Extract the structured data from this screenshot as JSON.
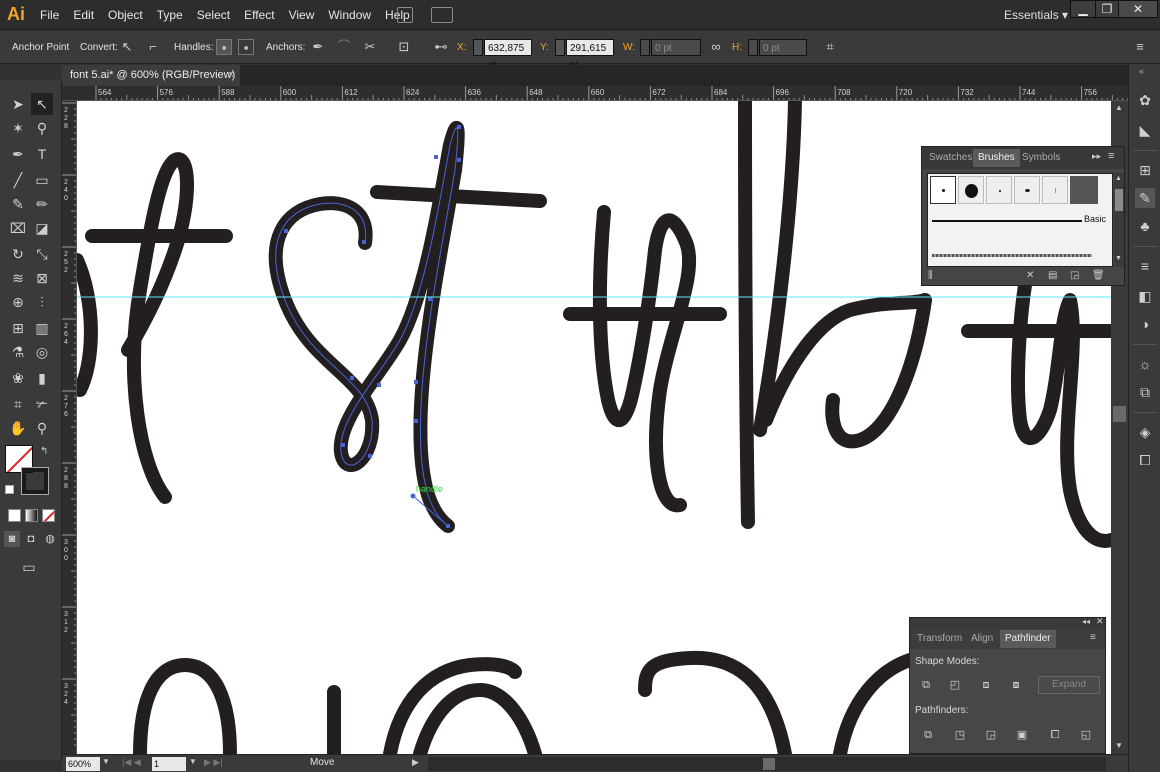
{
  "app": {
    "logo": "Ai"
  },
  "menu": [
    "File",
    "Edit",
    "Object",
    "Type",
    "Select",
    "Effect",
    "View",
    "Window",
    "Help"
  ],
  "workspace": {
    "label": "Essentials",
    "arrow": "▾"
  },
  "window_controls": {
    "minimize": "▁",
    "restore": "❐",
    "close": "✕"
  },
  "control_bar": {
    "anchor_point": "Anchor Point",
    "convert": "Convert:",
    "handles": "Handles:",
    "anchors": "Anchors:",
    "x_label": "X:",
    "x_value": "632,875 pt",
    "y_label": "Y:",
    "y_value": "291,615 pt",
    "w_label": "W:",
    "w_value": "0 pt",
    "h_label": "H:",
    "h_value": "0 pt"
  },
  "document_tab": {
    "title": "font 5.ai* @ 600% (RGB/Preview)",
    "close": "×"
  },
  "ruler": {
    "h_ticks": [
      "564",
      "576",
      "588",
      "600",
      "612",
      "624",
      "636",
      "648",
      "660",
      "672",
      "684",
      "696",
      "708",
      "720",
      "732",
      "744",
      "756"
    ],
    "v_ticks": [
      "228",
      "240",
      "252",
      "264",
      "276",
      "288",
      "300",
      "312",
      "324"
    ]
  },
  "canvas": {
    "handle_label": "handle"
  },
  "brushes_panel": {
    "tabs": [
      "Swatches",
      "Brushes",
      "Symbols"
    ],
    "active_tab": "Brushes",
    "basic_label": "Basic"
  },
  "pathfinder_panel": {
    "tabs": [
      "Transform",
      "Align",
      "Pathfinder"
    ],
    "active_tab": "Pathfinder",
    "shape_modes": "Shape Modes:",
    "pathfinders": "Pathfinders:",
    "expand": "Expand"
  },
  "status_bar": {
    "zoom": "600%",
    "page": "1",
    "tool": "Move"
  }
}
